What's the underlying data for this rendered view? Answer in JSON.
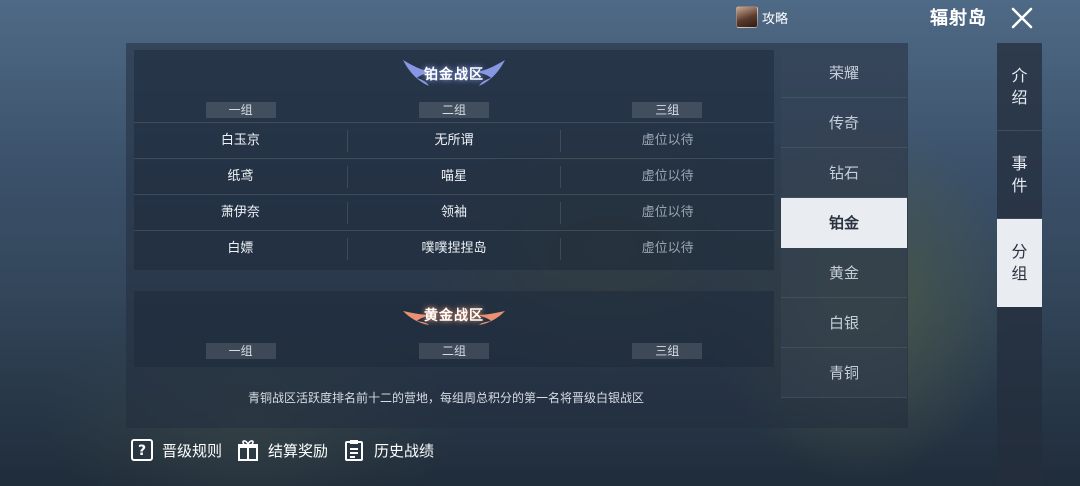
{
  "topbar": {
    "guide_label": "攻略",
    "island_title": "辐射岛"
  },
  "zones": {
    "platinum": {
      "title": "铂金战区",
      "columns": [
        "一组",
        "二组",
        "三组"
      ],
      "rows": [
        [
          "白玉京",
          "无所谓",
          "虚位以待"
        ],
        [
          "纸鸢",
          "喵星",
          "虚位以待"
        ],
        [
          "萧伊奈",
          "领袖",
          "虚位以待"
        ],
        [
          "白嫖",
          "噗噗捏捏岛",
          "虚位以待"
        ]
      ]
    },
    "gold": {
      "title": "黄金战区",
      "columns": [
        "一组",
        "二组",
        "三组"
      ]
    }
  },
  "footnote": "青铜战区活跃度排名前十二的营地，每组周总积分的第一名将晋级白银战区",
  "tiers": [
    "荣耀",
    "传奇",
    "钻石",
    "铂金",
    "黄金",
    "白银",
    "青铜"
  ],
  "active_tier": "铂金",
  "side_tabs": [
    {
      "line1": "介",
      "line2": "绍"
    },
    {
      "line1": "事",
      "line2": "件"
    },
    {
      "line1": "分",
      "line2": "组"
    }
  ],
  "bottom_actions": {
    "rules": "晋级规则",
    "rewards": "结算奖励",
    "history": "历史战绩"
  },
  "colors": {
    "active_tab_bg": "#e9ecf1",
    "platinum_glow": "#8fa2ff",
    "gold_glow": "#ff9a6a"
  }
}
